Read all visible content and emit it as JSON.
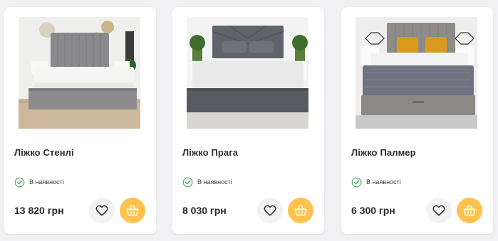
{
  "colors": {
    "page_bg": "#f1f1f3",
    "card_bg": "#ffffff",
    "accent": "#ffc150",
    "in_stock": "#4caf6e"
  },
  "products": [
    {
      "name": "Ліжко Стенлі",
      "availability": "В наявності",
      "price": "13 820 грн",
      "icons": {
        "availability": "check-circle-icon",
        "favorite": "heart-icon",
        "cart": "basket-icon"
      }
    },
    {
      "name": "Ліжко Прага",
      "availability": "В наявності",
      "price": "8 030 грн",
      "icons": {
        "availability": "check-circle-icon",
        "favorite": "heart-icon",
        "cart": "basket-icon"
      }
    },
    {
      "name": "Ліжко Палмер",
      "availability": "В наявності",
      "price": "6 300 грн",
      "icons": {
        "availability": "check-circle-icon",
        "favorite": "heart-icon",
        "cart": "basket-icon"
      }
    }
  ]
}
